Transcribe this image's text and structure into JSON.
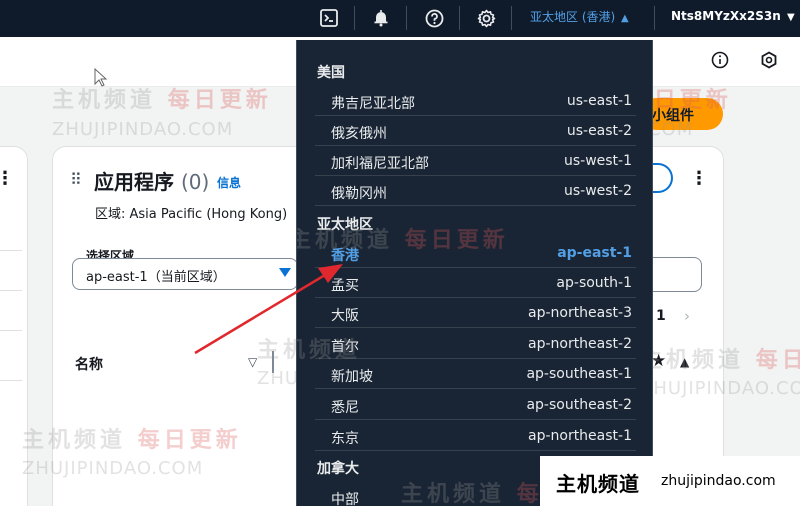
{
  "nav": {
    "icons": [
      "cloudshell-icon",
      "bell-icon",
      "help-icon",
      "gear-icon"
    ],
    "region_label": "亚太地区 (香港)",
    "account_label": "Nts8MYzXx2S3n"
  },
  "widget_button_label": "小组件",
  "card": {
    "title": "应用程序",
    "count": "(0)",
    "info_link": "信息",
    "region_line": "区域: Asia Pacific (Hong Kong)",
    "select_label": "选择区域",
    "select_value": "ap-east-1（当前区域）",
    "page_number": "1",
    "column_name": "名称"
  },
  "dropdown": {
    "groups": [
      {
        "label": "美国",
        "options": [
          {
            "name": "弗吉尼亚北部",
            "code": "us-east-1"
          },
          {
            "name": "俄亥俄州",
            "code": "us-east-2"
          },
          {
            "name": "加利福尼亚北部",
            "code": "us-west-1"
          },
          {
            "name": "俄勒冈州",
            "code": "us-west-2"
          }
        ]
      },
      {
        "label": "亚太地区",
        "options": [
          {
            "name": "香港",
            "code": "ap-east-1",
            "selected": true
          },
          {
            "name": "孟买",
            "code": "ap-south-1"
          },
          {
            "name": "大阪",
            "code": "ap-northeast-3"
          },
          {
            "name": "首尔",
            "code": "ap-northeast-2"
          },
          {
            "name": "新加坡",
            "code": "ap-southeast-1"
          },
          {
            "name": "悉尼",
            "code": "ap-southeast-2"
          },
          {
            "name": "东京",
            "code": "ap-northeast-1"
          }
        ]
      },
      {
        "label": "加拿大",
        "options": [
          {
            "name": "中部",
            "code": ""
          }
        ]
      }
    ]
  },
  "watermark": {
    "cn": "主机频道",
    "cn_red": "每日更新",
    "en": "ZHUJIPINDAO.COM"
  },
  "brand": {
    "cn": "主机频道",
    "url": "zhujipindao.com"
  },
  "colors": {
    "nav_bg": "#0f1b2a",
    "dropdown_bg": "#192534",
    "accent_blue": "#539fe5",
    "widget_orange": "#ff9900",
    "arrow_red": "#e0282e"
  }
}
